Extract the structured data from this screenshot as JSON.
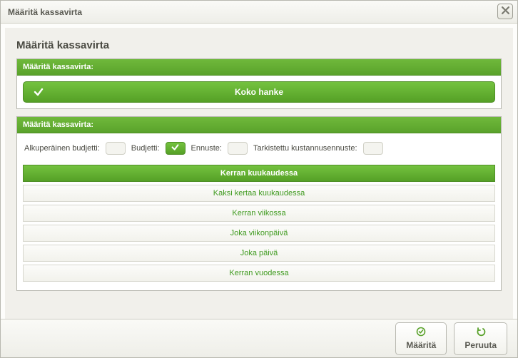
{
  "window": {
    "title": "Määritä kassavirta"
  },
  "page": {
    "heading": "Määritä kassavirta"
  },
  "panel1": {
    "header": "Määritä kassavirta:",
    "scope_button": "Koko hanke"
  },
  "panel2": {
    "header": "Määritä kassavirta:",
    "labels": {
      "original_budget": "Alkuperäinen budjetti:",
      "budget": "Budjetti:",
      "forecast": "Ennuste:",
      "revised_cost_forecast": "Tarkistettu kustannusennuste:"
    },
    "toggles": {
      "original_budget": false,
      "budget": true,
      "forecast": false,
      "revised_cost_forecast": false
    },
    "frequency_options": [
      "Kerran kuukaudessa",
      "Kaksi kertaa kuukaudessa",
      "Kerran viikossa",
      "Joka viikonpäivä",
      "Joka päivä",
      "Kerran vuodessa"
    ],
    "frequency_selected_index": 0
  },
  "footer": {
    "ok": "Määritä",
    "cancel": "Peruuta"
  },
  "colors": {
    "accent": "#5aa22b"
  }
}
